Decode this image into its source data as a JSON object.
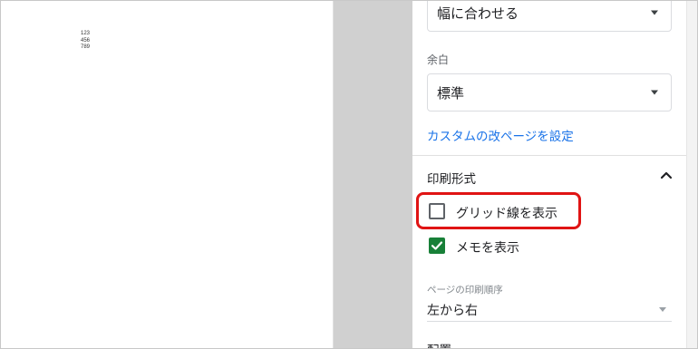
{
  "preview": {
    "cells": [
      "123",
      "456",
      "789"
    ]
  },
  "panel": {
    "fit_select": {
      "value": "幅に合わせる"
    },
    "margin": {
      "label": "余白",
      "value": "標準"
    },
    "custom_page_break_link": "カスタムの改ページを設定",
    "print_format": {
      "title": "印刷形式",
      "show_gridlines": {
        "label": "グリッド線を表示",
        "checked": false
      },
      "show_notes": {
        "label": "メモを表示",
        "checked": true
      }
    },
    "page_order": {
      "label": "ページの印刷順序",
      "value": "左から右"
    },
    "placement": {
      "label": "配置"
    }
  },
  "colors": {
    "link": "#1a73e8",
    "checkbox_checked": "#188038",
    "highlight": "#e01414",
    "gutter": "#d0d0d0"
  }
}
